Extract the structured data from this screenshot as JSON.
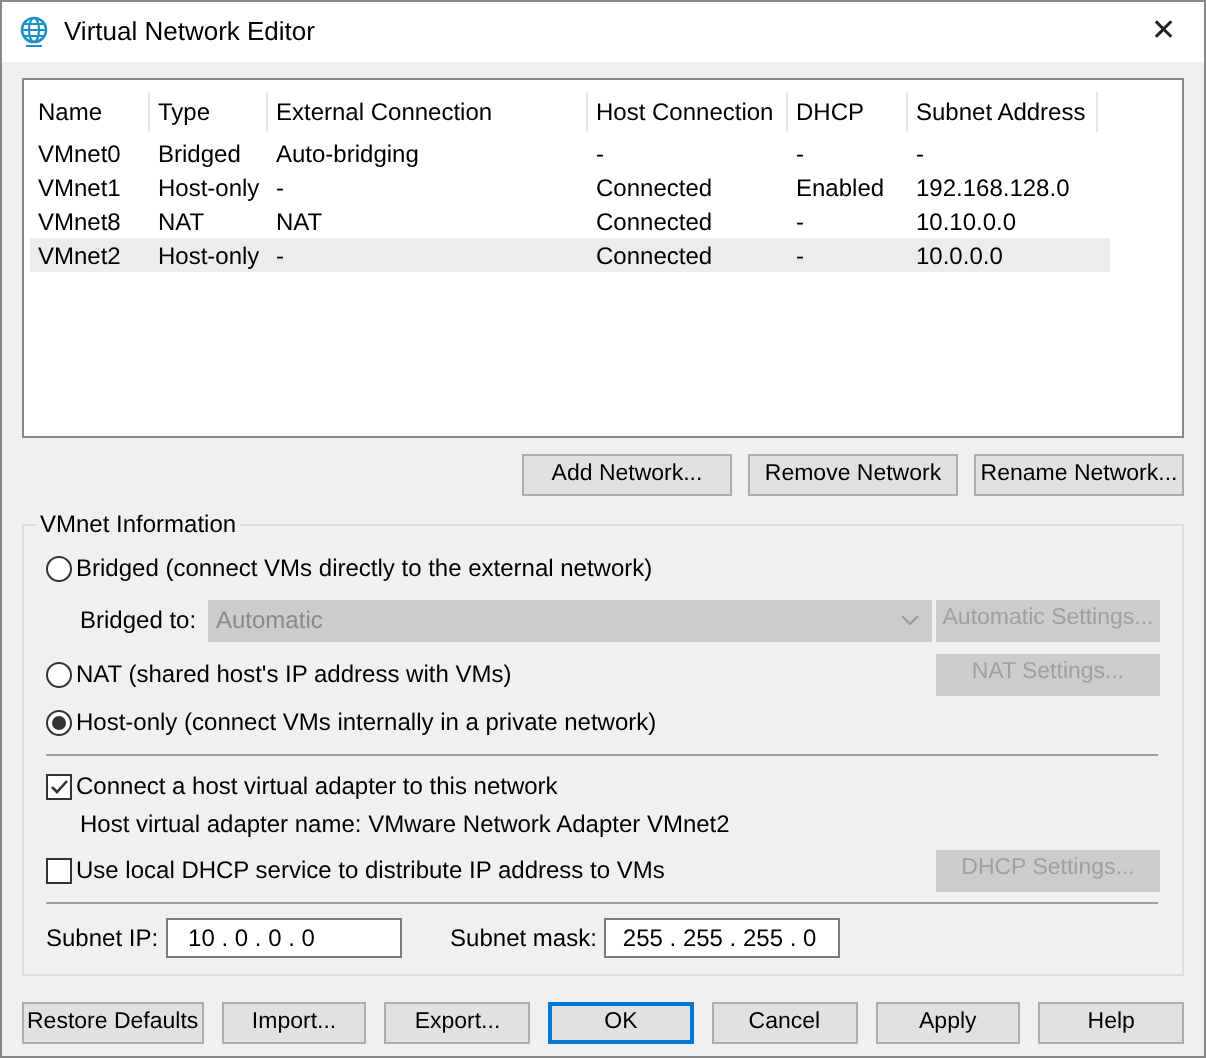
{
  "window": {
    "title": "Virtual Network Editor",
    "close": "✕"
  },
  "table": {
    "columns": [
      "Name",
      "Type",
      "External Connection",
      "Host Connection",
      "DHCP",
      "Subnet Address"
    ],
    "rows": [
      {
        "cells": [
          "VMnet0",
          "Bridged",
          "Auto-bridging",
          "-",
          "-",
          "-"
        ],
        "selected": false
      },
      {
        "cells": [
          "VMnet1",
          "Host-only",
          "-",
          "Connected",
          "Enabled",
          "192.168.128.0"
        ],
        "selected": false
      },
      {
        "cells": [
          "VMnet8",
          "NAT",
          "NAT",
          "Connected",
          "-",
          "10.10.0.0"
        ],
        "selected": false
      },
      {
        "cells": [
          "VMnet2",
          "Host-only",
          "-",
          "Connected",
          "-",
          "10.0.0.0"
        ],
        "selected": true
      }
    ]
  },
  "network_buttons": [
    "Add Network...",
    "Remove Network",
    "Rename Network..."
  ],
  "vmnet_info": {
    "title": "VMnet Information",
    "modes": [
      {
        "label": "Bridged (connect VMs directly to the external network)",
        "selected": false
      },
      {
        "label": "NAT (shared host's IP address with VMs)",
        "selected": false,
        "button": {
          "label": "NAT Settings...",
          "disabled": true
        }
      },
      {
        "label": "Host-only (connect VMs internally in a private network)",
        "selected": true
      }
    ],
    "bridged_to": {
      "label": "Bridged to:",
      "value": "Automatic",
      "disabled": true,
      "button": {
        "label": "Automatic Settings...",
        "disabled": true
      }
    },
    "connect_adapter": {
      "label": "Connect a host virtual adapter to this network",
      "checked": true
    },
    "adapter_name": "Host virtual adapter name: VMware Network Adapter VMnet2",
    "dhcp": {
      "label": "Use local DHCP service to distribute IP address to VMs",
      "checked": false,
      "button": {
        "label": "DHCP Settings...",
        "disabled": true
      }
    },
    "subnet_ip": {
      "label": "Subnet IP:",
      "value": "10 . 0 . 0 . 0"
    },
    "subnet_mask": {
      "label": "Subnet mask:",
      "value": "255 . 255 . 255 . 0"
    }
  },
  "footer_buttons": [
    {
      "label": "Restore Defaults",
      "default": false
    },
    {
      "label": "Import...",
      "default": false
    },
    {
      "label": "Export...",
      "default": false
    },
    {
      "label": "OK",
      "default": true
    },
    {
      "label": "Cancel",
      "default": false
    },
    {
      "label": "Apply",
      "default": false
    },
    {
      "label": "Help",
      "default": false
    }
  ]
}
